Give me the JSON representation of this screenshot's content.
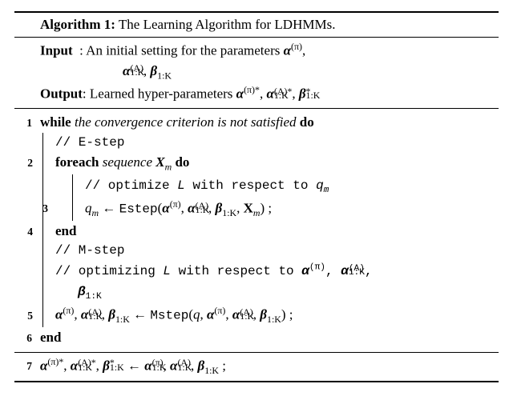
{
  "algo_label": "Algorithm 1:",
  "algo_title": "The Learning Algorithm for LDHMMs.",
  "input_kw": "Input",
  "output_kw": "Output",
  "input_text1": ": An initial setting for the parameters ",
  "input_text2": ", ",
  "input_text3": ", ",
  "output_text1": ": Learned hyper-parameters ",
  "output_text2": ", ",
  "output_text3": ", ",
  "line1_while": "while",
  "line1_cond": "the convergence criterion is not satisfied",
  "line1_do": "do",
  "comment_estep": "// E-step",
  "line2_foreach": "foreach",
  "line2_seq": "sequence",
  "line2_X": "X",
  "line2_m": "m",
  "line2_do": "do",
  "comment_optimizeL_wrt_qm": "// optimize ",
  "comment_L": "L",
  "comment_wrt": " with respect to ",
  "comment_qm_sym": "q",
  "line3_qm": "q",
  "line3_arrow": " ← ",
  "line3_fn": "Estep",
  "line3_open": "(",
  "line3_close": ") ;",
  "line4_end": "end",
  "comment_mstep": "// M-step",
  "comment_optimizing": "// optimizing ",
  "comment_wrt2": " with respect to ",
  "line5_arrow": " ← ",
  "line5_fn": "Mstep",
  "line5_open": "(",
  "line5_close": ") ;",
  "line6_end": "end",
  "line7_arrow": " ← ",
  "line7_end": " ;",
  "sym": {
    "alpha": "α",
    "beta": "β",
    "pi": "(π)",
    "A": "(A)",
    "oneK": "1:K",
    "piStar": "(π)*",
    "Astar": "(A)*",
    "star": "*",
    "q": "q",
    "m": "m",
    "X": "X",
    "comma": ", "
  },
  "lineno": {
    "l1": "1",
    "l2": "2",
    "l3": "3",
    "l4": "4",
    "l5": "5",
    "l6": "6",
    "l7": "7"
  }
}
